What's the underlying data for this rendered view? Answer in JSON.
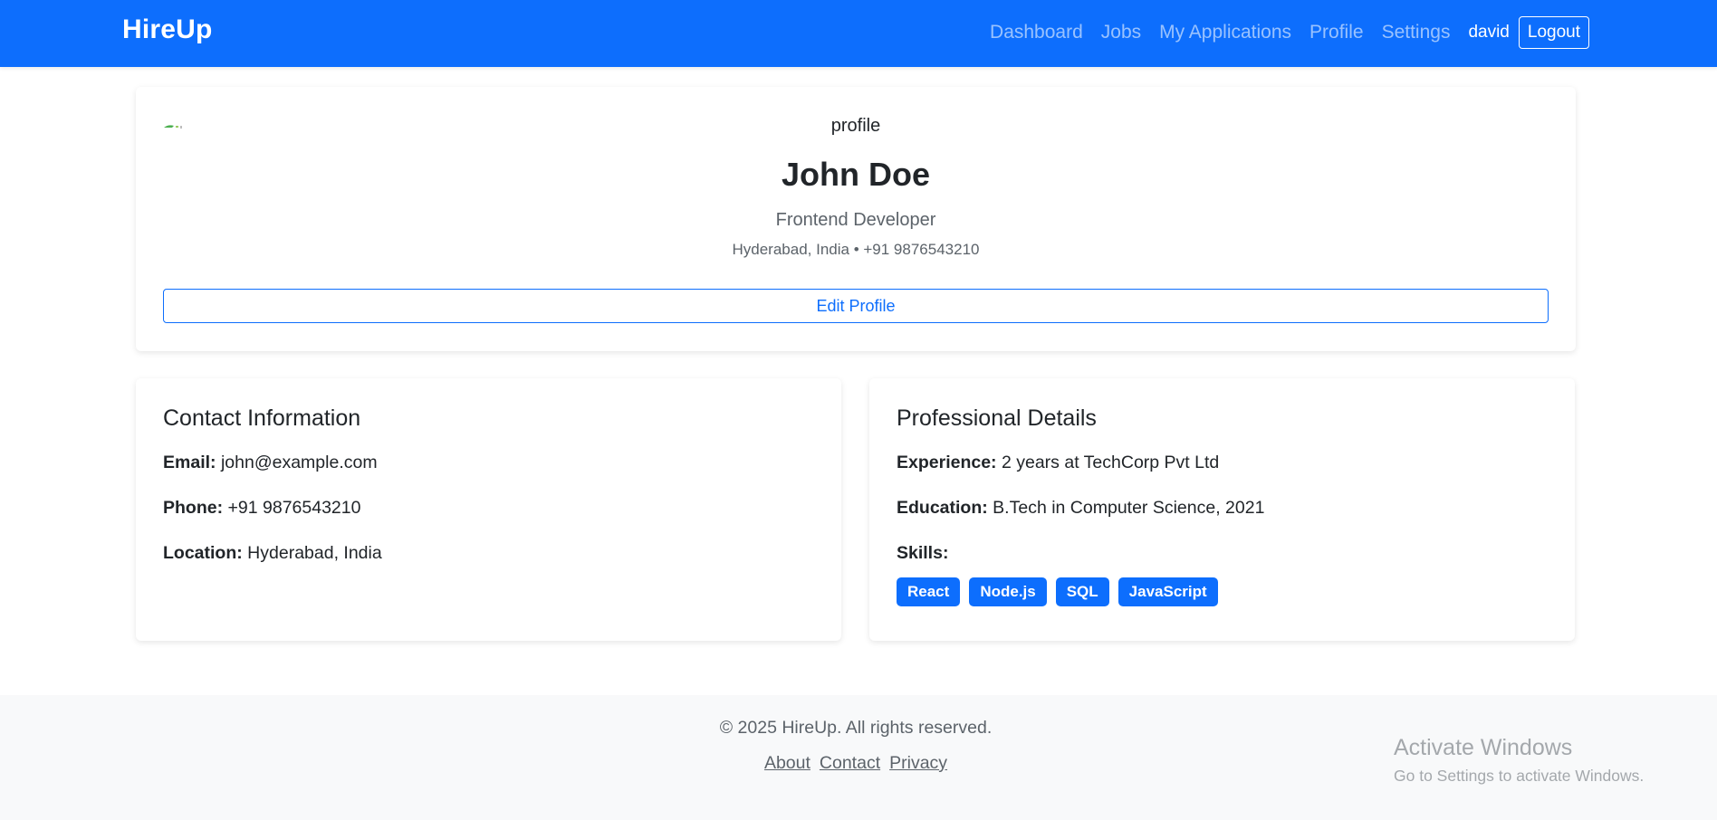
{
  "navbar": {
    "brand": "HireUp",
    "links": [
      "Dashboard",
      "Jobs",
      "My Applications",
      "Profile",
      "Settings"
    ],
    "username": "david",
    "logout_label": "Logout",
    "bg_color": "#0d6efd"
  },
  "profile": {
    "avatar_alt": "profile",
    "name": "John Doe",
    "title": "Frontend Developer",
    "meta": "Hyderabad, India • +91 9876543210",
    "edit_label": "Edit Profile"
  },
  "contact": {
    "heading": "Contact Information",
    "email_label": "Email:",
    "email": "john@example.com",
    "phone_label": "Phone:",
    "phone": "+91 9876543210",
    "location_label": "Location:",
    "location": "Hyderabad, India"
  },
  "professional": {
    "heading": "Professional Details",
    "experience_label": "Experience:",
    "experience": "2 years at TechCorp Pvt Ltd",
    "education_label": "Education:",
    "education": "B.Tech in Computer Science, 2021",
    "skills_label": "Skills:",
    "skills": [
      "React",
      "Node.js",
      "SQL",
      "JavaScript"
    ],
    "skill_color": "#0d6efd"
  },
  "footer": {
    "copyright": "© 2025 HireUp. All rights reserved.",
    "links": [
      "About",
      "Contact",
      "Privacy"
    ]
  },
  "watermark": {
    "title": "Activate Windows",
    "subtitle": "Go to Settings to activate Windows."
  }
}
